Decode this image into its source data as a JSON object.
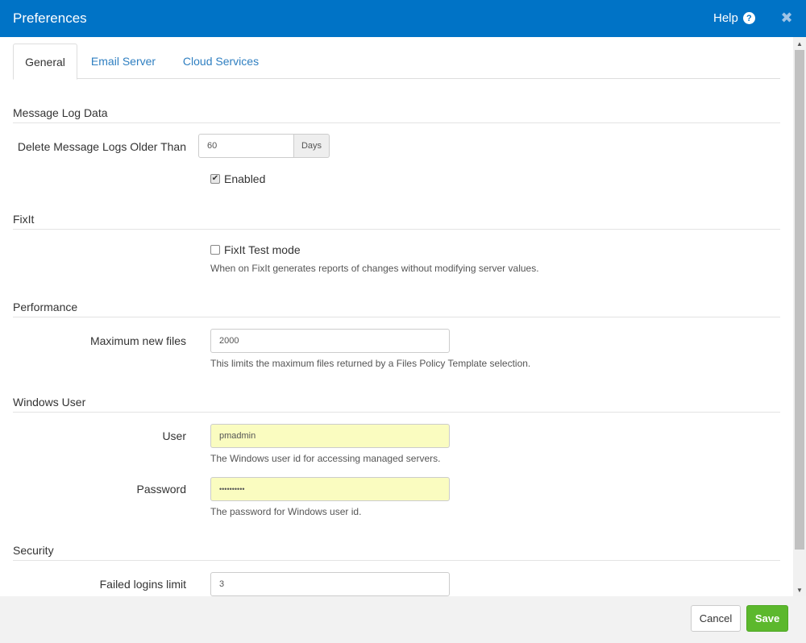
{
  "window": {
    "title": "Preferences",
    "help_label": "Help",
    "help_icon": "?",
    "close_icon": "✖"
  },
  "tabs": [
    {
      "label": "General",
      "active": true
    },
    {
      "label": "Email Server",
      "active": false
    },
    {
      "label": "Cloud Services",
      "active": false
    }
  ],
  "sections": {
    "message_log": {
      "title": "Message Log Data",
      "delete_label": "Delete Message Logs Older Than",
      "delete_value": "60",
      "delete_unit": "Days",
      "enabled_label": "Enabled",
      "enabled_checked": true
    },
    "fixit": {
      "title": "FixIt",
      "test_mode_label": "FixIt Test mode",
      "test_mode_checked": false,
      "help": "When on FixIt generates reports of changes without modifying server values."
    },
    "performance": {
      "title": "Performance",
      "max_files_label": "Maximum new files",
      "max_files_value": "2000",
      "help": "This limits the maximum files returned by a Files Policy Template selection."
    },
    "windows_user": {
      "title": "Windows User",
      "user_label": "User",
      "user_value": "pmadmin",
      "user_help": "The Windows user id for accessing managed servers.",
      "password_label": "Password",
      "password_value": "••••••••••",
      "password_help": "The password for Windows user id."
    },
    "security": {
      "title": "Security",
      "failed_logins_label": "Failed logins limit",
      "failed_logins_value": "3"
    }
  },
  "footer": {
    "cancel_label": "Cancel",
    "save_label": "Save"
  },
  "colors": {
    "titlebar": "#0073c6",
    "link": "#2f7fc1",
    "save": "#5cb82d",
    "autofill": "#fafcc0"
  }
}
